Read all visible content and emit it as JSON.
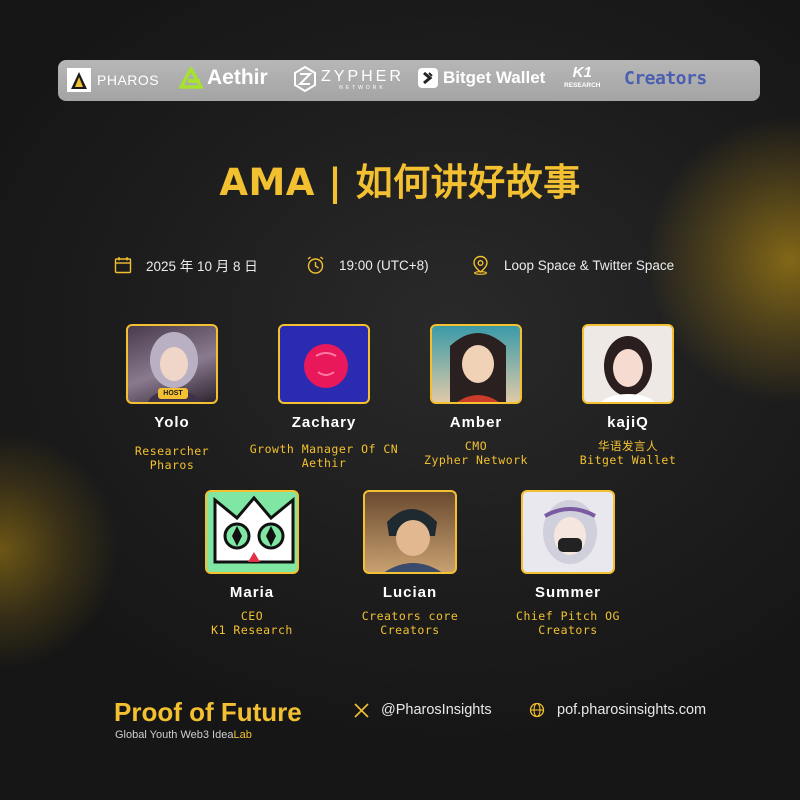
{
  "partners": {
    "pharos": "PHAROS",
    "aethir": "Aethir",
    "zypher": "ZYPHER",
    "zypher_sub": "NETWORK",
    "bitget": "Bitget Wallet",
    "k1": "K1",
    "k1_sub": "RESEARCH",
    "creators": "Creators"
  },
  "title": "AMA | 如何讲好故事",
  "event": {
    "date": "2025 年 10 月 8 日",
    "time": "19:00  (UTC+8)",
    "location": "Loop Space & Twitter Space",
    "icons": [
      "calendar-icon",
      "clock-icon",
      "location-pin-icon"
    ]
  },
  "host_badge": "HOST",
  "speakers": [
    {
      "name": "Yolo",
      "role": "Researcher",
      "org": "Pharos"
    },
    {
      "name": "Zachary",
      "role": "Growth Manager Of CN",
      "org": "Aethir"
    },
    {
      "name": "Amber",
      "role": "CMO",
      "org": "Zypher Network"
    },
    {
      "name": "kajiQ",
      "role": "华语发言人",
      "org": "Bitget Wallet"
    },
    {
      "name": "Maria",
      "role": "CEO",
      "org": "K1 Research"
    },
    {
      "name": "Lucian",
      "role": "Creators core",
      "org": "Creators"
    },
    {
      "name": "Summer",
      "role": "Chief Pitch OG",
      "org": "Creators"
    }
  ],
  "footer": {
    "brand": "Proof of Future",
    "tagline_main": "Global Youth Web3 Idea",
    "tagline_accent": "Lab",
    "twitter": "@PharosInsights",
    "website": "pof.pharosinsights.com"
  },
  "colors": {
    "accent": "#f2c030",
    "background": "#1b1b1b",
    "partner_bar": "#aeaeae"
  }
}
